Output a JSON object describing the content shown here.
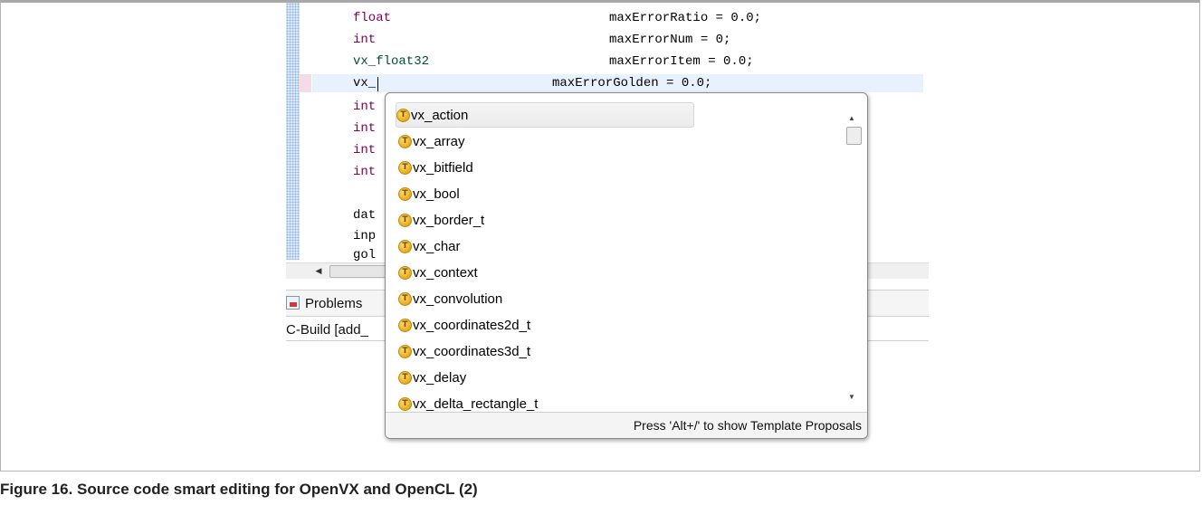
{
  "editor": {
    "lines": [
      {
        "type": "float",
        "rest": "maxErrorRatio = 0.0;",
        "type_class": "kw"
      },
      {
        "type": "int",
        "rest": "maxErrorNum = 0;",
        "type_class": "kw"
      },
      {
        "type": "vx_float32",
        "rest": "maxErrorItem = 0.0;",
        "type_class": "ty"
      },
      {
        "type": "vx_",
        "rest": "maxErrorGolden = 0.0;",
        "type_class": "plain"
      },
      {
        "type": "int",
        "rest": "",
        "type_class": "kw"
      },
      {
        "type": "int",
        "rest": "",
        "type_class": "kw"
      },
      {
        "type": "int",
        "rest": "",
        "type_class": "kw"
      },
      {
        "type": "int",
        "rest": "",
        "type_class": "kw"
      },
      {
        "type": "",
        "rest": "",
        "type_class": "plain"
      },
      {
        "type": "dat",
        "rest": "",
        "type_class": "plain"
      },
      {
        "type": "inp",
        "rest": "",
        "type_class": "plain"
      },
      {
        "type": "gol",
        "rest": "",
        "type_class": "plain"
      }
    ]
  },
  "views": {
    "problems_label": "Problems",
    "console_label": "C-Build [add_"
  },
  "popup": {
    "icon_letter": "T",
    "items": [
      "vx_action",
      "vx_array",
      "vx_bitfield",
      "vx_bool",
      "vx_border_t",
      "vx_char",
      "vx_context",
      "vx_convolution",
      "vx_coordinates2d_t",
      "vx_coordinates3d_t",
      "vx_delay",
      "vx_delta_rectangle_t"
    ],
    "selected_index": 0,
    "footer": "Press 'Alt+/' to show Template Proposals"
  },
  "caption": "Figure 16.  Source code smart editing for OpenVX and OpenCL (2)"
}
